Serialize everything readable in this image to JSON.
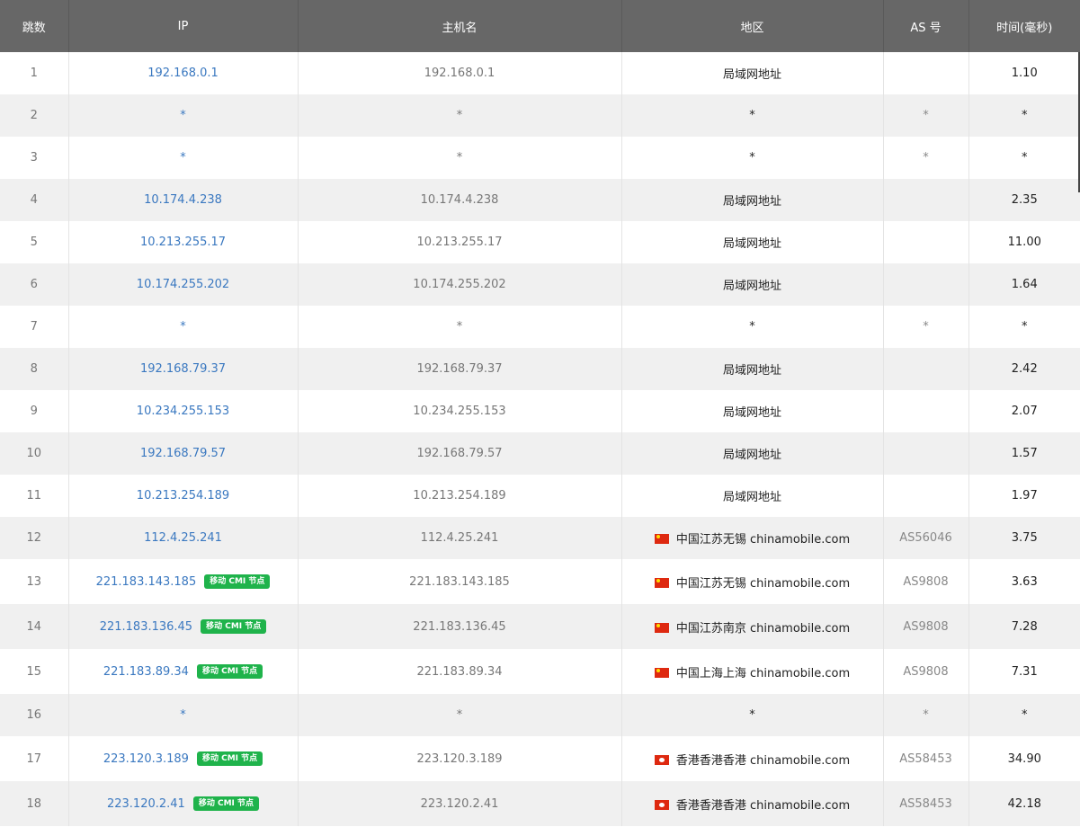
{
  "headers": {
    "hop": "跳数",
    "ip": "IP",
    "host": "主机名",
    "region": "地区",
    "as": "AS 号",
    "time": "时间(毫秒)"
  },
  "rows": [
    {
      "hop": "1",
      "ip": "192.168.0.1",
      "badge": "",
      "host": "192.168.0.1",
      "flag": "",
      "region": "局域网地址",
      "as": "",
      "time": "1.10"
    },
    {
      "hop": "2",
      "ip": "*",
      "badge": "",
      "host": "*",
      "flag": "",
      "region": "*",
      "as": "*",
      "time": "*"
    },
    {
      "hop": "3",
      "ip": "*",
      "badge": "",
      "host": "*",
      "flag": "",
      "region": "*",
      "as": "*",
      "time": "*"
    },
    {
      "hop": "4",
      "ip": "10.174.4.238",
      "badge": "",
      "host": "10.174.4.238",
      "flag": "",
      "region": "局域网地址",
      "as": "",
      "time": "2.35"
    },
    {
      "hop": "5",
      "ip": "10.213.255.17",
      "badge": "",
      "host": "10.213.255.17",
      "flag": "",
      "region": "局域网地址",
      "as": "",
      "time": "11.00"
    },
    {
      "hop": "6",
      "ip": "10.174.255.202",
      "badge": "",
      "host": "10.174.255.202",
      "flag": "",
      "region": "局域网地址",
      "as": "",
      "time": "1.64"
    },
    {
      "hop": "7",
      "ip": "*",
      "badge": "",
      "host": "*",
      "flag": "",
      "region": "*",
      "as": "*",
      "time": "*"
    },
    {
      "hop": "8",
      "ip": "192.168.79.37",
      "badge": "",
      "host": "192.168.79.37",
      "flag": "",
      "region": "局域网地址",
      "as": "",
      "time": "2.42"
    },
    {
      "hop": "9",
      "ip": "10.234.255.153",
      "badge": "",
      "host": "10.234.255.153",
      "flag": "",
      "region": "局域网地址",
      "as": "",
      "time": "2.07"
    },
    {
      "hop": "10",
      "ip": "192.168.79.57",
      "badge": "",
      "host": "192.168.79.57",
      "flag": "",
      "region": "局域网地址",
      "as": "",
      "time": "1.57"
    },
    {
      "hop": "11",
      "ip": "10.213.254.189",
      "badge": "",
      "host": "10.213.254.189",
      "flag": "",
      "region": "局域网地址",
      "as": "",
      "time": "1.97"
    },
    {
      "hop": "12",
      "ip": "112.4.25.241",
      "badge": "",
      "host": "112.4.25.241",
      "flag": "cn-flag-icon",
      "region": "中国江苏无锡 chinamobile.com",
      "as": "AS56046",
      "time": "3.75"
    },
    {
      "hop": "13",
      "ip": "221.183.143.185",
      "badge": "移动 CMI 节点",
      "host": "221.183.143.185",
      "flag": "cn-flag-icon",
      "region": "中国江苏无锡 chinamobile.com",
      "as": "AS9808",
      "time": "3.63"
    },
    {
      "hop": "14",
      "ip": "221.183.136.45",
      "badge": "移动 CMI 节点",
      "host": "221.183.136.45",
      "flag": "cn-flag-icon",
      "region": "中国江苏南京 chinamobile.com",
      "as": "AS9808",
      "time": "7.28"
    },
    {
      "hop": "15",
      "ip": "221.183.89.34",
      "badge": "移动 CMI 节点",
      "host": "221.183.89.34",
      "flag": "cn-flag-icon",
      "region": "中国上海上海 chinamobile.com",
      "as": "AS9808",
      "time": "7.31"
    },
    {
      "hop": "16",
      "ip": "*",
      "badge": "",
      "host": "*",
      "flag": "",
      "region": "*",
      "as": "*",
      "time": "*"
    },
    {
      "hop": "17",
      "ip": "223.120.3.189",
      "badge": "移动 CMI 节点",
      "host": "223.120.3.189",
      "flag": "hk-flag-icon",
      "region": "香港香港香港 chinamobile.com",
      "as": "AS58453",
      "time": "34.90"
    },
    {
      "hop": "18",
      "ip": "223.120.2.41",
      "badge": "移动 CMI 节点",
      "host": "223.120.2.41",
      "flag": "hk-flag-icon",
      "region": "香港香港香港 chinamobile.com",
      "as": "AS58453",
      "time": "42.18"
    }
  ],
  "colors": {
    "header_bg": "#676767",
    "ip_link": "#3a78c0",
    "badge_bg": "#1fb34b",
    "stripe": "#f0f0f0"
  }
}
